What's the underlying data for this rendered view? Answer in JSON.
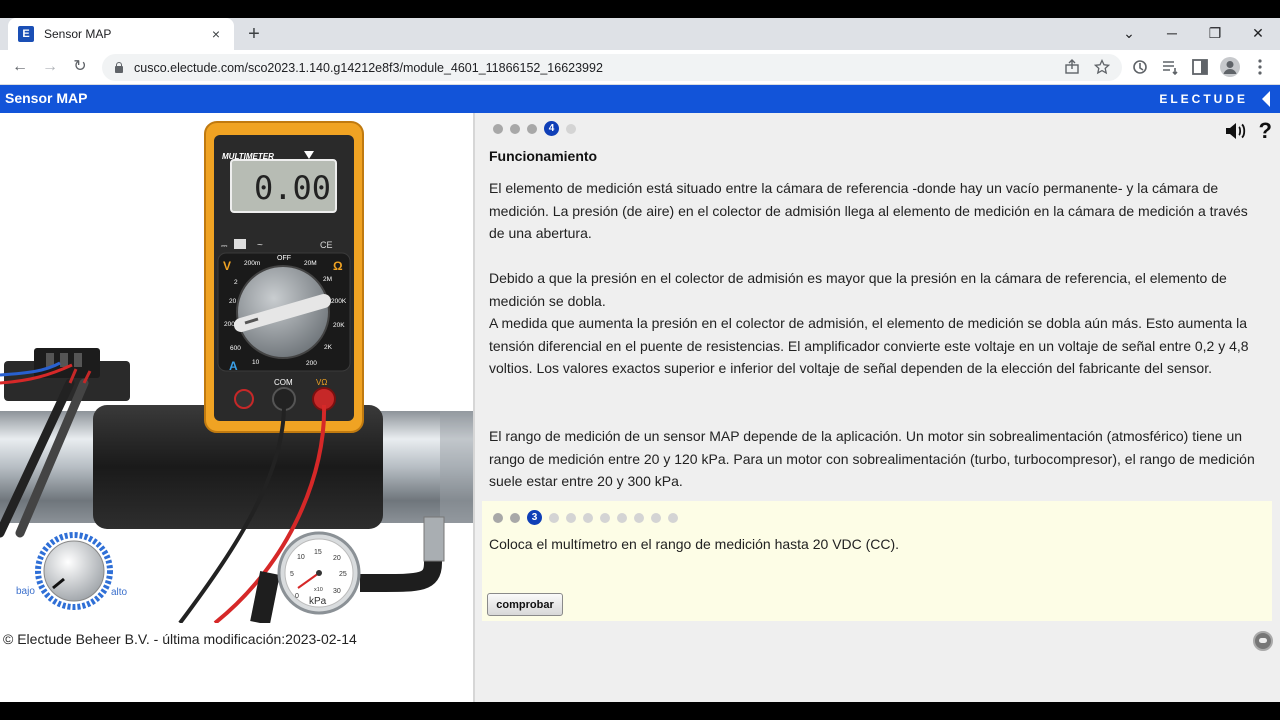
{
  "browser": {
    "tab_title": "Sensor MAP",
    "favicon_letter": "E",
    "tab_close": "×",
    "new_tab": "+",
    "url": "cusco.electude.com/sco2023.1.140.g14212e8f3/module_4601_11866152_16623992",
    "controls": {
      "dropdown": "⌄",
      "minimize": "─",
      "restore": "❐",
      "close": "✕"
    },
    "nav": {
      "back": "←",
      "forward": "→",
      "reload": "↻"
    }
  },
  "app": {
    "title": "Sensor MAP",
    "brand": "ELECTUDE"
  },
  "simulation": {
    "multimeter_label": "MULTIMETER",
    "display_value": "0.00",
    "dial_labels": {
      "off": "OFF",
      "volts": "V",
      "ohms": "Ω",
      "amps": "A",
      "com": "COM",
      "vohm": "VΩ",
      "ce": "CE"
    },
    "dial_ranges_left": [
      "200m",
      "2",
      "20",
      "200",
      "600"
    ],
    "dial_ranges_right": [
      "20M",
      "2M",
      "200K",
      "20K",
      "2K",
      "200"
    ],
    "dial_ranges_bottom": [
      "20",
      "10"
    ],
    "gauge_ticks": [
      "0",
      "5",
      "10",
      "15",
      "20",
      "25",
      "30"
    ],
    "gauge_unit": "kPa",
    "gauge_multiplier": "x10",
    "knob_low": "bajo",
    "knob_high": "alto"
  },
  "footer": {
    "copyright": "© Electude Beheer B.V. - última modificación:2023-02-14"
  },
  "content": {
    "progress_active": "4",
    "section_title": "Funcionamiento",
    "paragraphs": [
      "El elemento de medición está situado entre la cámara de referencia -donde hay un vacío permanente- y la cámara de medición. La presión (de aire) en el colector de admisión llega al elemento de medición en la cámara de medición a través de una abertura.",
      "Debido a que la presión en el colector de admisión es mayor que la presión en la cámara de referencia, el elemento de medición se dobla.",
      "A medida que aumenta la presión en el colector de admisión, el elemento de medición se dobla aún más. Esto aumenta la tensión diferencial en el puente de resistencias. El amplificador convierte este voltaje en un voltaje de señal entre 0,2 y 4,8 voltios. Los valores exactos superior e inferior del voltaje de señal dependen de la elección del fabricante del sensor.",
      "El rango de medición de un sensor MAP depende de la aplicación. Un motor sin sobrealimentación (atmosférico) tiene un rango de medición entre 20 y 120 kPa. Para un motor con sobrealimentación (turbo, turbocompresor), el rango de medición suele estar entre 20 y 300 kPa."
    ],
    "help_symbol": "?"
  },
  "task": {
    "progress_active": "3",
    "instruction": "Coloca el multímetro en el rango de medición hasta 20 VDC (CC).",
    "check_label": "comprobar"
  }
}
